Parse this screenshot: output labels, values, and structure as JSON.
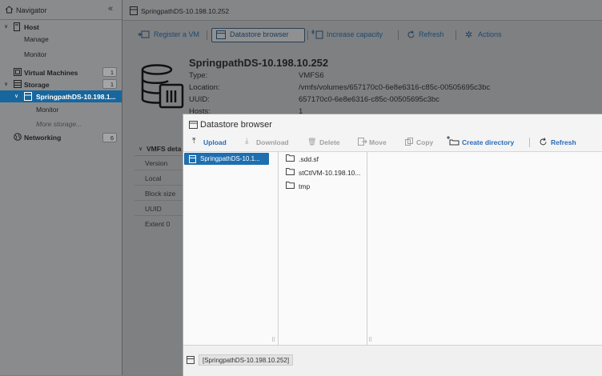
{
  "navigator": {
    "title": "Navigator",
    "host": "Host",
    "manage": "Manage",
    "monitor": "Monitor",
    "virtual_machines": "Virtual Machines",
    "vm_count": "1",
    "storage": "Storage",
    "storage_count": "1",
    "datastore": "SpringpathDS-10.198.1...",
    "ds_monitor": "Monitor",
    "more_storage": "More storage...",
    "networking": "Networking",
    "net_count": "6"
  },
  "header": {
    "title": "SpringpathDS-10.198.10.252"
  },
  "toolbar": {
    "register_vm": "Register a VM",
    "datastore_browser": "Datastore browser",
    "increase_capacity": "Increase capacity",
    "refresh": "Refresh",
    "actions": "Actions"
  },
  "datastore": {
    "name": "SpringpathDS-10.198.10.252",
    "type_label": "Type:",
    "type_value": "VMFS6",
    "location_label": "Location:",
    "location_value": "/vmfs/volumes/657170c0-6e8e6316-c85c-00505695c3bc",
    "uuid_label": "UUID:",
    "uuid_value": "657170c0-6e8e6316-c85c-00505695c3bc",
    "hosts_label": "Hosts:",
    "hosts_value": "1"
  },
  "vmfs": {
    "header": "VMFS deta",
    "rows": [
      "Version",
      "Local",
      "Block size",
      "UUID",
      "Extent 0"
    ]
  },
  "dialog": {
    "title": "Datastore browser",
    "upload": "Upload",
    "download": "Download",
    "delete": "Delete",
    "move": "Move",
    "copy": "Copy",
    "create_directory": "Create directory",
    "refresh": "Refresh",
    "datastore_item": "SpringpathDS-10.1...",
    "files": [
      ".sdd.sf",
      "stCtlVM-10.198.10...",
      "tmp"
    ],
    "path": "[SpringpathDS-10.198.10.252]"
  },
  "colors": {
    "selection": "#17679e",
    "link": "#2b6bb5"
  }
}
